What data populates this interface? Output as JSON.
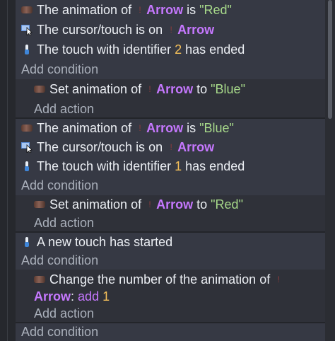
{
  "ui": {
    "add_condition": "Add condition",
    "add_action": "Add action"
  },
  "event1": {
    "cond1": {
      "pre": "The animation of",
      "obj": "Arrow",
      "mid": "is",
      "value": "\"Red\""
    },
    "cond2": {
      "pre": "The cursor/touch is on",
      "obj": "Arrow"
    },
    "cond3": {
      "pre": "The touch with identifier",
      "num": "2",
      "post": "has ended"
    },
    "action1": {
      "pre": "Set animation of",
      "obj": "Arrow",
      "mid": "to",
      "value": "\"Blue\""
    }
  },
  "event2": {
    "cond1": {
      "pre": "The animation of",
      "obj": "Arrow",
      "mid": "is",
      "value": "\"Blue\""
    },
    "cond2": {
      "pre": "The cursor/touch is on",
      "obj": "Arrow"
    },
    "cond3": {
      "pre": "The touch with identifier",
      "num": "1",
      "post": "has ended"
    },
    "action1": {
      "pre": "Set animation of",
      "obj": "Arrow",
      "mid": "to",
      "value": "\"Red\""
    }
  },
  "event3": {
    "cond1": {
      "text": "A new touch has started"
    },
    "action1": {
      "pre": "Change the number of the animation of",
      "obj": "Arrow",
      "colon": ":",
      "op": "add",
      "num": "1"
    }
  },
  "colors": {
    "object": "#c678ff",
    "string": "#a7d98a",
    "number": "#f5c05a",
    "condition_bg": "#363944",
    "action_bg": "#2f3139"
  },
  "icons": [
    "sprite-animation-icon",
    "cursor-icon",
    "touch-icon"
  ]
}
